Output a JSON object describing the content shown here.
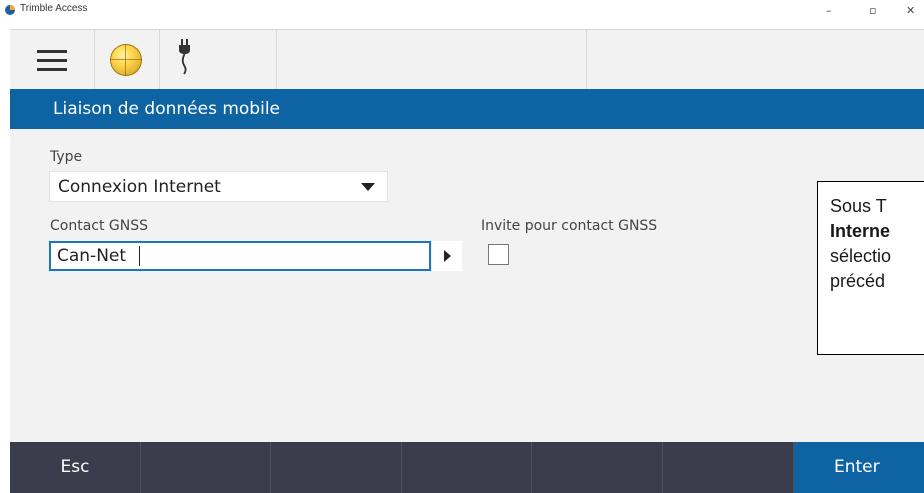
{
  "window": {
    "title": "Trimble Access",
    "minimize_glyph": "–",
    "maximize_glyph": "▫",
    "close_glyph": "✕"
  },
  "toolbar": {
    "icons": [
      "hamburger-menu-icon",
      "globe-icon",
      "power-plug-icon"
    ]
  },
  "header": {
    "title": "Liaison de données mobile"
  },
  "form": {
    "type_label": "Type",
    "type_value": "Connexion Internet",
    "contact_label": "Contact GNSS",
    "contact_value": "Can-Net",
    "prompt_label": "Invite pour contact GNSS",
    "prompt_checked": false
  },
  "callout": {
    "line1": "Sous T",
    "line2_bold": "Interne",
    "line3": "sélectio",
    "line4": "précéd"
  },
  "softkeys": {
    "esc": "Esc",
    "enter": "Enter"
  },
  "colors": {
    "accent": "#0e64a3",
    "softkey_bar": "#3b3c4c",
    "content_bg": "#f2f2f2"
  }
}
